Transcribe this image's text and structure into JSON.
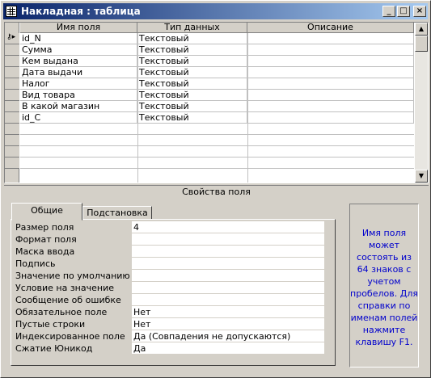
{
  "window": {
    "title": "Накладная : таблица",
    "minimize_glyph": "_",
    "maximize_glyph": "□",
    "close_glyph": "×"
  },
  "grid": {
    "columns": [
      "Имя поля",
      "Тип данных",
      "Описание"
    ],
    "rows": [
      {
        "name": "id_N",
        "type": "Текстовый",
        "desc": ""
      },
      {
        "name": "Сумма",
        "type": "Текстовый",
        "desc": ""
      },
      {
        "name": "Кем выдана",
        "type": "Текстовый",
        "desc": ""
      },
      {
        "name": "Дата выдачи",
        "type": "Текстовый",
        "desc": ""
      },
      {
        "name": "Налог",
        "type": "Текстовый",
        "desc": ""
      },
      {
        "name": "Вид товара",
        "type": "Текстовый",
        "desc": ""
      },
      {
        "name": "В какой магазин",
        "type": "Текстовый",
        "desc": ""
      },
      {
        "name": "id_C",
        "type": "Текстовый",
        "desc": ""
      }
    ],
    "key_icon": "key-icon"
  },
  "properties": {
    "section_title": "Свойства поля",
    "tabs": [
      "Общие",
      "Подстановка"
    ],
    "items": [
      {
        "label": "Размер поля",
        "value": "4"
      },
      {
        "label": "Формат поля",
        "value": ""
      },
      {
        "label": "Маска ввода",
        "value": ""
      },
      {
        "label": "Подпись",
        "value": ""
      },
      {
        "label": "Значение по умолчанию",
        "value": ""
      },
      {
        "label": "Условие на значение",
        "value": ""
      },
      {
        "label": "Сообщение об ошибке",
        "value": ""
      },
      {
        "label": "Обязательное поле",
        "value": "Нет"
      },
      {
        "label": "Пустые строки",
        "value": "Нет"
      },
      {
        "label": "Индексированное поле",
        "value": "Да (Совпадения не допускаются)"
      },
      {
        "label": "Сжатие Юникод",
        "value": "Да"
      }
    ],
    "help_text": "Имя поля может состоять из 64 знаков с учетом пробелов. Для справки по именам полей нажмите клавишу F1."
  },
  "colors": {
    "titlebar_start": "#0a246a",
    "titlebar_end": "#a6caf0",
    "help_text": "#0000cc"
  }
}
